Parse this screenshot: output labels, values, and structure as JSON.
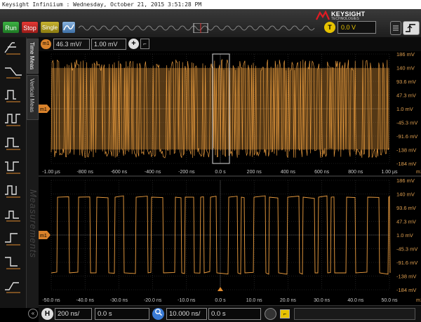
{
  "window": {
    "title": "Keysight Infiniium : Wednesday, October 21, 2015 3:51:28 PM"
  },
  "brand": {
    "name": "KEYSIGHT",
    "tagline": "TECHNOLOGIES"
  },
  "toolbar": {
    "run_label": "Run",
    "stop_label": "Stop",
    "single_label": "Single",
    "trigger_icon_label": "T",
    "trigger_level": "0.0 V"
  },
  "side_tabs": {
    "time_meas": "Time Meas",
    "vertical_meas": "Vertical Meas",
    "measurements": "Measurements"
  },
  "math": {
    "badge": "m1",
    "scale": "46.3 mV/",
    "offset": "1.00 mV"
  },
  "upper_axis": {
    "y_labels": [
      "186 mV",
      "140 mV",
      "93.6 mV",
      "47.3 mV",
      "1.0 mV",
      "-45.3 mV",
      "-91.6 mV",
      "-138 mV",
      "-184 mV"
    ],
    "x_labels": [
      "-1.00 µs",
      "-800 ns",
      "-600 ns",
      "-400 ns",
      "-200 ns",
      "0.0 s",
      "200 ns",
      "400 ns",
      "600 ns",
      "800 ns",
      "1.00 µs"
    ],
    "x_unit_tag": "m1"
  },
  "lower_axis": {
    "y_labels": [
      "186 mV",
      "140 mV",
      "93.6 mV",
      "47.3 mV",
      "1.0 mV",
      "-45.3 mV",
      "-91.6 mV",
      "-138 mV",
      "-184 mV"
    ],
    "x_labels": [
      "-50.0 ns",
      "-40.0 ns",
      "-30.0 ns",
      "-20.0 ns",
      "-10.0 ns",
      "0.0 s",
      "10.0 ns",
      "20.0 ns",
      "30.0 ns",
      "40.0 ns",
      "50.0 ns"
    ],
    "x_unit_tag": "m1"
  },
  "channel_marker": "m1",
  "timebase": {
    "h_label": "H",
    "scale": "200 ns/",
    "position": "0.0 s",
    "zoom_scale": "10.000 ns/",
    "zoom_position": "0.0 s"
  },
  "colors": {
    "trace": "#f0a040",
    "grid": "#3a3a3a",
    "accent": "#e6c200"
  }
}
